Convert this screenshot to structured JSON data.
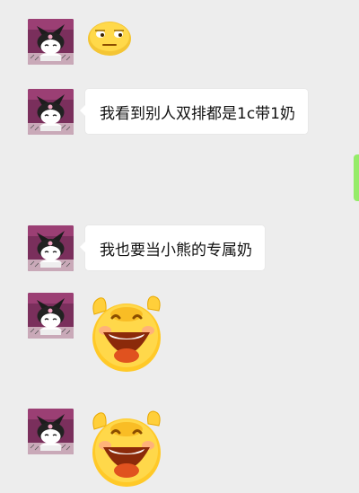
{
  "conversation": {
    "messages": [
      {
        "type": "emoji_sticker",
        "sender": "friend",
        "sticker": "smug-face-icon"
      },
      {
        "type": "text",
        "sender": "friend",
        "text": "我看到别人双排都是1c带1奶"
      },
      {
        "type": "text",
        "sender": "self",
        "text": ""
      },
      {
        "type": "text",
        "sender": "friend",
        "text": "我也要当小熊的专属奶"
      },
      {
        "type": "emoji_sticker",
        "sender": "friend",
        "sticker": "laughing-face-icon"
      },
      {
        "type": "emoji_sticker",
        "sender": "friend",
        "sticker": "laughing-face-icon"
      }
    ]
  },
  "colors": {
    "background": "#ededed",
    "incoming_bubble": "#ffffff",
    "outgoing_bubble": "#95ec69",
    "avatar_bg": "#8b3a6a"
  }
}
